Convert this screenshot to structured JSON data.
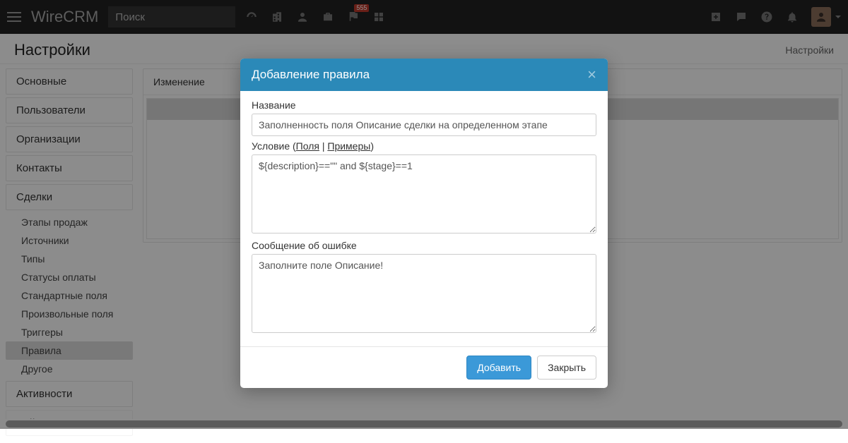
{
  "topbar": {
    "logo": "WireCRM",
    "search_placeholder": "Поиск",
    "flag_badge": "555"
  },
  "page": {
    "title": "Настройки",
    "breadcrumb": "Настройки"
  },
  "sidebar": {
    "main": [
      "Основные",
      "Пользователи",
      "Организации",
      "Контакты"
    ],
    "deals_label": "Сделки",
    "subitems": [
      "Этапы продаж",
      "Источники",
      "Типы",
      "Статусы оплаты",
      "Стандартные поля",
      "Произвольные поля",
      "Триггеры",
      "Правила",
      "Другое"
    ],
    "active_sub": 7,
    "tail": [
      "Активности",
      "Действия"
    ]
  },
  "panel": {
    "header": "Изменение"
  },
  "modal": {
    "title": "Добавление правила",
    "name_label": "Название",
    "name_value": "Заполненность поля Описание сделки на определенном этапе",
    "condition_label_prefix": "Условие (",
    "condition_fields_link": "Поля",
    "condition_sep": " | ",
    "condition_examples_link": "Примеры",
    "condition_label_suffix": ")",
    "condition_value": "${description}==\"\" and ${stage}==1",
    "error_label": "Сообщение об ошибке",
    "error_value": "Заполните поле Описание!",
    "submit": "Добавить",
    "cancel": "Закрыть"
  }
}
